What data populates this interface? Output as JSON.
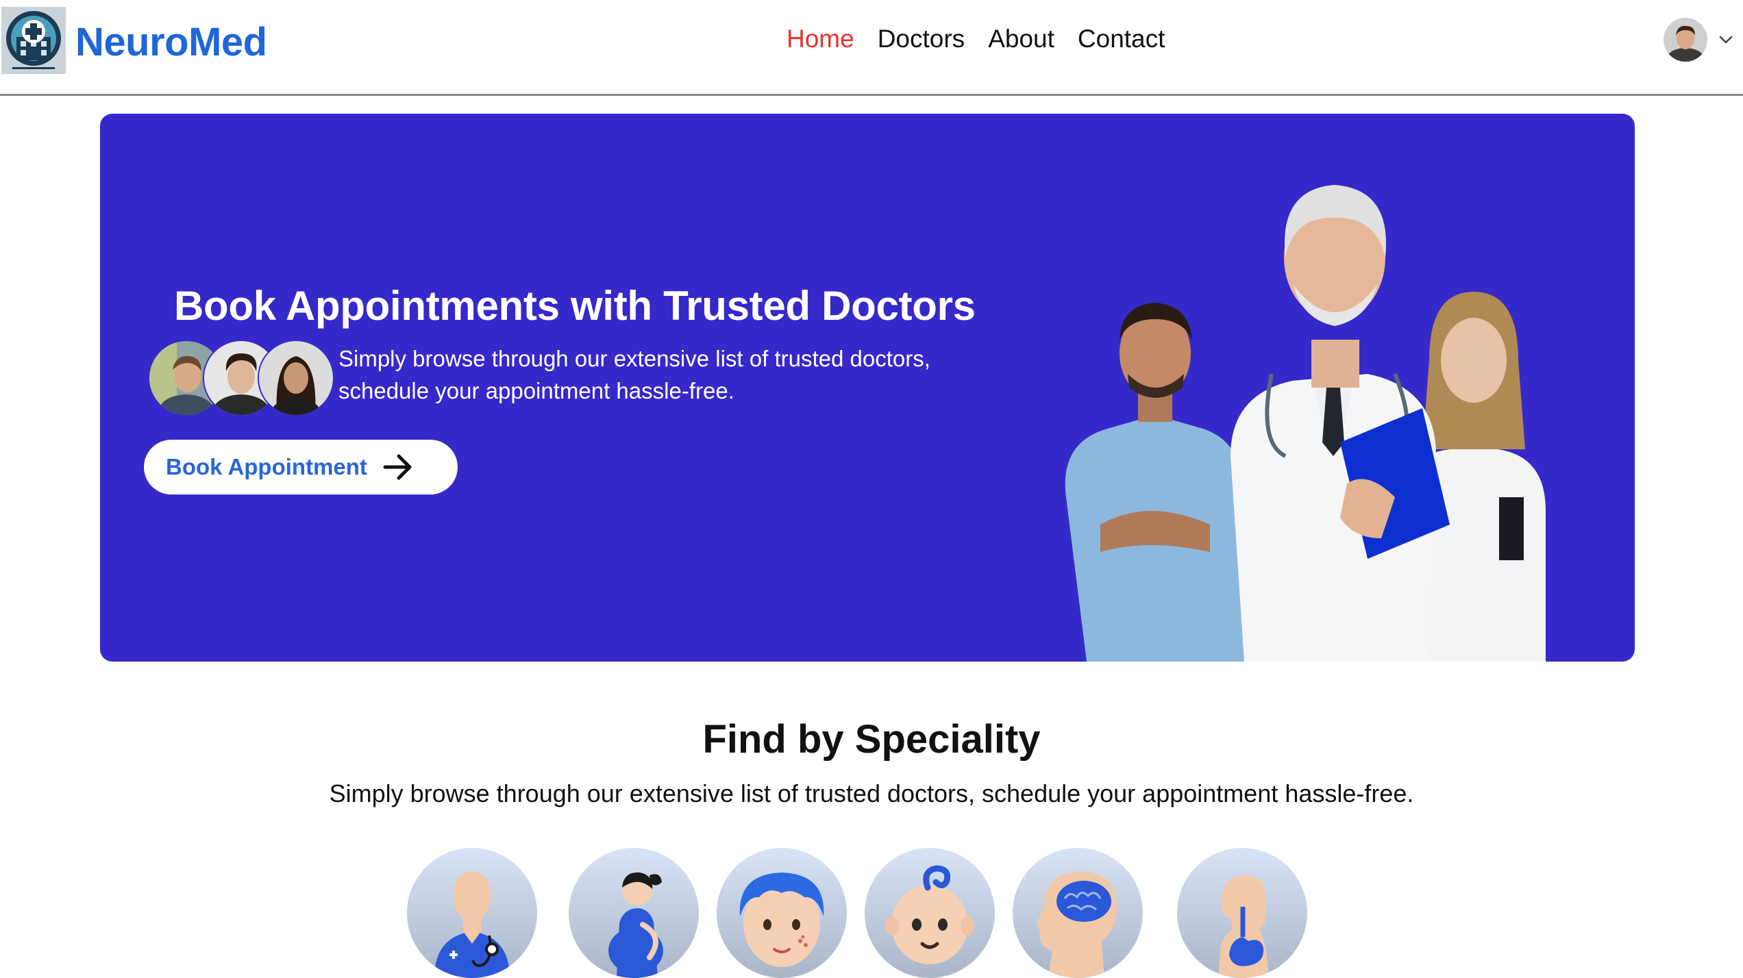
{
  "brand": {
    "name": "NeuroMed",
    "logo_icon": "hospital-cross-icon"
  },
  "nav": {
    "links": [
      {
        "label": "Home",
        "active": true
      },
      {
        "label": "Doctors",
        "active": false
      },
      {
        "label": "About",
        "active": false
      },
      {
        "label": "Contact",
        "active": false
      }
    ],
    "profile_icon": "user-avatar",
    "dropdown_icon": "chevron-down-icon"
  },
  "hero": {
    "title": "Book Appointments with Trusted Doctors",
    "subtitle": "Simply browse through our extensive list of trusted doctors, schedule your appointment hassle-free.",
    "cta_label": "Book Appointment",
    "cta_icon": "arrow-right-icon",
    "background_color": "#3629c9"
  },
  "speciality": {
    "title": "Find by Speciality",
    "subtitle": "Simply browse through our extensive list of trusted doctors, schedule your appointment hassle-free.",
    "items": [
      {
        "icon": "general-physician-icon"
      },
      {
        "icon": "gynecologist-icon"
      },
      {
        "icon": "dermatologist-icon"
      },
      {
        "icon": "pediatrician-icon"
      },
      {
        "icon": "neurologist-icon"
      },
      {
        "icon": "gastroenterologist-icon"
      }
    ]
  },
  "colors": {
    "brand": "#1f66d9",
    "active_link": "#e8322c",
    "hero": "#3629c9"
  }
}
